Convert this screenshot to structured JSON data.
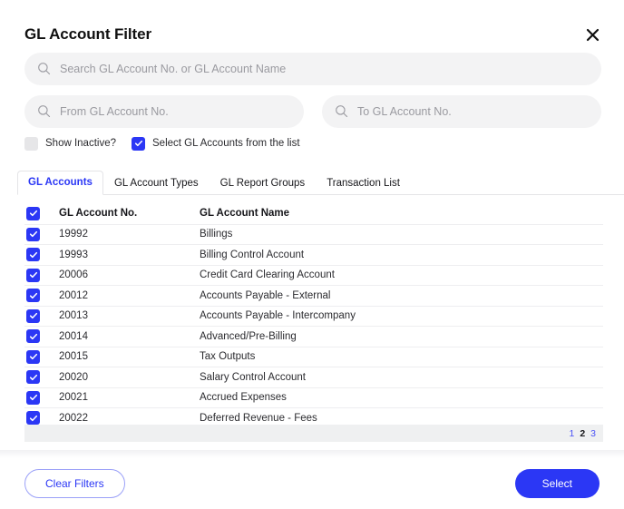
{
  "dialog": {
    "title": "GL Account Filter",
    "close_icon": "close-icon"
  },
  "search": {
    "icon": "search-icon",
    "placeholder": "Search GL Account No. or GL Account Name",
    "value": ""
  },
  "range": {
    "from": {
      "icon": "search-icon",
      "placeholder": "From GL Account No.",
      "value": ""
    },
    "to": {
      "icon": "search-icon",
      "placeholder": "To GL Account No.",
      "value": ""
    }
  },
  "options": [
    {
      "label": "Show Inactive?",
      "checked": false
    },
    {
      "label": "Select GL Accounts from the list",
      "checked": true
    }
  ],
  "tabs": [
    {
      "label": "GL Accounts",
      "active": true
    },
    {
      "label": "GL Account Types",
      "active": false
    },
    {
      "label": "GL Report Groups",
      "active": false
    },
    {
      "label": "Transaction List",
      "active": false
    }
  ],
  "table": {
    "select_all_checked": true,
    "columns": [
      "GL Account No.",
      "GL Account Name"
    ],
    "rows": [
      {
        "checked": true,
        "no": "19992",
        "name": "Billings"
      },
      {
        "checked": true,
        "no": "19993",
        "name": "Billing Control Account"
      },
      {
        "checked": true,
        "no": "20006",
        "name": "Credit Card Clearing Account"
      },
      {
        "checked": true,
        "no": "20012",
        "name": "Accounts Payable - External"
      },
      {
        "checked": true,
        "no": "20013",
        "name": "Accounts Payable - Intercompany"
      },
      {
        "checked": true,
        "no": "20014",
        "name": "Advanced/Pre-Billing"
      },
      {
        "checked": true,
        "no": "20015",
        "name": "Tax Outputs"
      },
      {
        "checked": true,
        "no": "20020",
        "name": "Salary Control Account"
      },
      {
        "checked": true,
        "no": "20021",
        "name": "Accrued Expenses"
      },
      {
        "checked": true,
        "no": "20022",
        "name": "Deferred Revenue - Fees"
      }
    ]
  },
  "pagination": {
    "pages": [
      "1",
      "2",
      "3"
    ],
    "current": "2"
  },
  "footer": {
    "clear_label": "Clear Filters",
    "select_label": "Select"
  },
  "colors": {
    "accent": "#2b37f5",
    "page_link": "#4b53f6",
    "field_bg": "#f3f3f4",
    "checkbox_off": "#e6e6e8",
    "row_border": "#eeeef0",
    "pagination_bg": "#eff0f1",
    "text": "#16161a",
    "placeholder": "#9a9aa0"
  }
}
